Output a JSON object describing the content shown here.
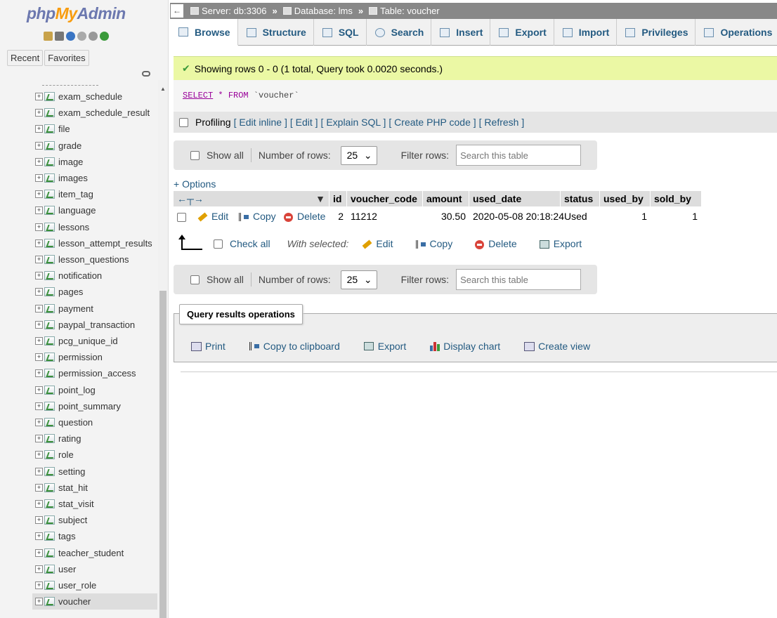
{
  "logo": {
    "php": "php",
    "my": "My",
    "admin": "Admin"
  },
  "nav": {
    "recent": "Recent",
    "favorites": "Favorites",
    "tables": [
      "exam_schedule",
      "exam_schedule_result",
      "file",
      "grade",
      "image",
      "images",
      "item_tag",
      "language",
      "lessons",
      "lesson_attempt_results",
      "lesson_questions",
      "notification",
      "pages",
      "payment",
      "paypal_transaction",
      "pcg_unique_id",
      "permission",
      "permission_access",
      "point_log",
      "point_summary",
      "question",
      "rating",
      "role",
      "setting",
      "stat_hit",
      "stat_visit",
      "subject",
      "tags",
      "teacher_student",
      "user",
      "user_role",
      "voucher"
    ],
    "selected": "voucher"
  },
  "breadcrumb": {
    "server": "Server: db:3306",
    "database": "Database: lms",
    "table": "Table: voucher"
  },
  "tabs": [
    "Browse",
    "Structure",
    "SQL",
    "Search",
    "Insert",
    "Export",
    "Import",
    "Privileges",
    "Operations"
  ],
  "active_tab": "Browse",
  "success": "Showing rows 0 - 0 (1 total, Query took 0.0020 seconds.)",
  "sql": {
    "select": "SELECT",
    "star": "*",
    "from": "FROM",
    "table": "`voucher`"
  },
  "profiling": {
    "label": "Profiling",
    "links": [
      "[ Edit inline ]",
      "[ Edit ]",
      "[ Explain SQL ]",
      "[ Create PHP code ]",
      "[ Refresh ]"
    ]
  },
  "controls": {
    "show_all": "Show all",
    "num_rows_label": "Number of rows:",
    "num_rows": "25",
    "filter_label": "Filter rows:",
    "filter_placeholder": "Search this table"
  },
  "options": "+ Options",
  "table": {
    "headers": [
      "id",
      "voucher_code",
      "amount",
      "used_date",
      "status",
      "used_by",
      "sold_by"
    ],
    "row": {
      "id": "2",
      "voucher_code": "11212",
      "amount": "30.50",
      "used_date": "2020-05-08 20:18:24",
      "status": "Used",
      "used_by": "1",
      "sold_by": "1"
    },
    "row_actions": {
      "edit": "Edit",
      "copy": "Copy",
      "delete": "Delete"
    }
  },
  "with_selected": {
    "check_all": "Check all",
    "label": "With selected:",
    "edit": "Edit",
    "copy": "Copy",
    "delete": "Delete",
    "export": "Export"
  },
  "qro": {
    "legend": "Query results operations",
    "print": "Print",
    "copy": "Copy to clipboard",
    "export": "Export",
    "chart": "Display chart",
    "view": "Create view"
  },
  "colors": {
    "accent": "#235a81",
    "success_bg": "#ebf8a4"
  }
}
